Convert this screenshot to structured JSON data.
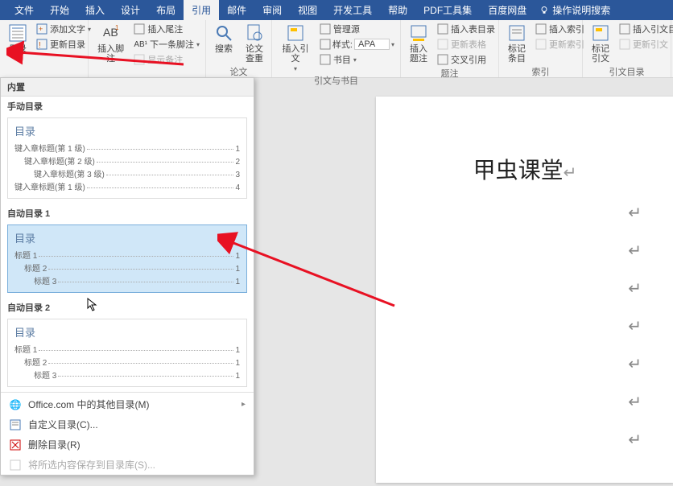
{
  "titlebar": {
    "tabs": [
      "文件",
      "开始",
      "插入",
      "设计",
      "布局",
      "引用",
      "邮件",
      "审阅",
      "视图",
      "开发工具",
      "帮助",
      "PDF工具集",
      "百度网盘"
    ],
    "active_tab": "引用",
    "search_hint": "操作说明搜索"
  },
  "ribbon": {
    "group_toc": {
      "main": "目录",
      "items": [
        "添加文字",
        "更新目录"
      ]
    },
    "group_footnote": {
      "main": "插入脚注",
      "items": [
        "插入尾注",
        "下一条脚注",
        "显示备注"
      ],
      "label": ""
    },
    "group_search": {
      "search": "搜索",
      "lookup": "论文\n查重",
      "label": "论文"
    },
    "group_citation": {
      "insert": "插入引文",
      "items": [
        "管理源",
        "样式:",
        "书目"
      ],
      "style_value": "APA",
      "label": "引文与书目"
    },
    "group_caption": {
      "insert": "插入题注",
      "items": [
        "插入表目录",
        "更新表格",
        "交叉引用"
      ],
      "label": "题注"
    },
    "group_index": {
      "mark": "标记\n条目",
      "items": [
        "插入索引",
        "更新索引"
      ],
      "label": "索引"
    },
    "group_cite": {
      "mark": "标记引文",
      "items": [
        "插入引文目",
        "更新引文"
      ],
      "label": "引文目录"
    }
  },
  "toc_panel": {
    "header": "内置",
    "manual": {
      "title": "手动目录",
      "toc_label": "目录",
      "lines": [
        {
          "label": "键入章标题(第 1 级)",
          "page": "1",
          "indent": 0
        },
        {
          "label": "键入章标题(第 2 级)",
          "page": "2",
          "indent": 1
        },
        {
          "label": "键入章标题(第 3 级)",
          "page": "3",
          "indent": 2
        },
        {
          "label": "键入章标题(第 1 级)",
          "page": "4",
          "indent": 0
        }
      ]
    },
    "auto1": {
      "title": "自动目录 1",
      "toc_label": "目录",
      "lines": [
        {
          "label": "标题 1",
          "page": "1",
          "indent": 0
        },
        {
          "label": "标题 2",
          "page": "1",
          "indent": 1
        },
        {
          "label": "标题 3",
          "page": "1",
          "indent": 2
        }
      ]
    },
    "auto2": {
      "title": "自动目录 2",
      "toc_label": "目录",
      "lines": [
        {
          "label": "标题 1",
          "page": "1",
          "indent": 0
        },
        {
          "label": "标题 2",
          "page": "1",
          "indent": 1
        },
        {
          "label": "标题 3",
          "page": "1",
          "indent": 2
        }
      ]
    },
    "menu": {
      "office_more": "Office.com 中的其他目录(M)",
      "custom": "自定义目录(C)...",
      "remove": "删除目录(R)",
      "save_gallery": "将所选内容保存到目录库(S)..."
    }
  },
  "document": {
    "title": "甲虫课堂",
    "return_glyph": "↵",
    "para_glyph": "↵"
  }
}
